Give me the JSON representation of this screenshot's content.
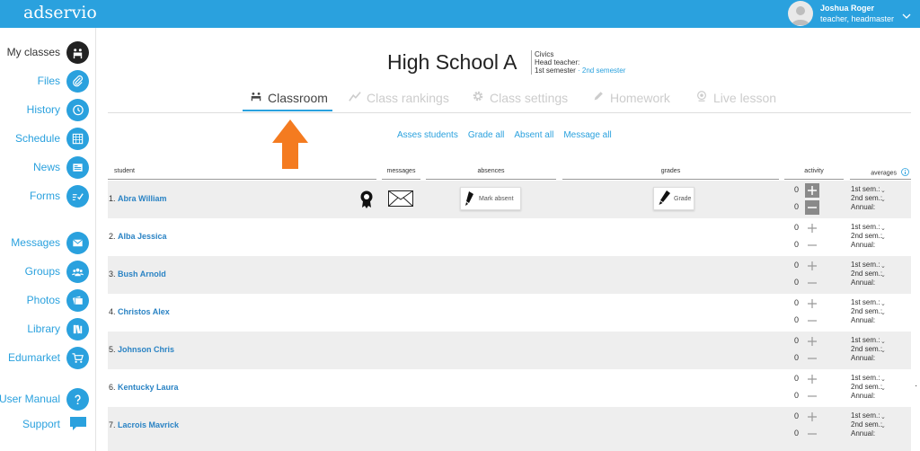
{
  "app": {
    "logo": "adservio"
  },
  "user": {
    "name": "Joshua Roger",
    "role": "teacher, headmaster"
  },
  "sidebar": {
    "items": [
      {
        "label": "My classes",
        "icon": "classroom-icon",
        "active": true
      },
      {
        "label": "Files",
        "icon": "paperclip-icon"
      },
      {
        "label": "History",
        "icon": "history-icon"
      },
      {
        "label": "Schedule",
        "icon": "calendar-icon"
      },
      {
        "label": "News",
        "icon": "newspaper-icon"
      },
      {
        "label": "Forms",
        "icon": "form-check-icon"
      },
      {
        "label": "Messages",
        "icon": "envelope-icon"
      },
      {
        "label": "Groups",
        "icon": "group-icon"
      },
      {
        "label": "Photos",
        "icon": "photos-icon"
      },
      {
        "label": "Library",
        "icon": "library-icon"
      },
      {
        "label": "Edumarket",
        "icon": "cart-icon"
      },
      {
        "label": "User Manual",
        "icon": "question-icon"
      },
      {
        "label": "Support",
        "icon": "chat-icon"
      }
    ]
  },
  "header": {
    "school": "High School A",
    "subject": "Civics",
    "head_teacher": "Head teacher:",
    "semester_active": "1st semester",
    "semester_sep": " · ",
    "semester_other": "2nd semester"
  },
  "tabs": [
    {
      "label": "Classroom",
      "icon": "classroom-icon",
      "active": true
    },
    {
      "label": "Class rankings",
      "icon": "chart-line-icon"
    },
    {
      "label": "Class settings",
      "icon": "gear-icon"
    },
    {
      "label": "Homework",
      "icon": "pencil-icon"
    },
    {
      "label": "Live lesson",
      "icon": "webcam-icon"
    }
  ],
  "actions": [
    "Asses students",
    "Grade all",
    "Absent all",
    "Message all"
  ],
  "columns": {
    "student": "student",
    "messages": "messages",
    "absences": "absences",
    "grades": "grades",
    "activity": "activity",
    "averages": "averages"
  },
  "buttons": {
    "mark_absent": "Mark absent",
    "grade": "Grade"
  },
  "averages_labels": {
    "sem1": "1st sem.:",
    "sem2": "2nd sem.:",
    "annual": "Annual:"
  },
  "students": [
    {
      "num": "1.",
      "name": "Abra William",
      "activity_plus": "0",
      "activity_minus": "0"
    },
    {
      "num": "2.",
      "name": "Alba Jessica",
      "activity_plus": "0",
      "activity_minus": "0"
    },
    {
      "num": "3.",
      "name": "Bush Arnold",
      "activity_plus": "0",
      "activity_minus": "0"
    },
    {
      "num": "4.",
      "name": "Christos Alex",
      "activity_plus": "0",
      "activity_minus": "0"
    },
    {
      "num": "5.",
      "name": "Johnson Chris",
      "activity_plus": "0",
      "activity_minus": "0"
    },
    {
      "num": "6.",
      "name": "Kentucky Laura",
      "activity_plus": "0",
      "activity_minus": "0"
    },
    {
      "num": "7.",
      "name": "Lacrois Mavrick",
      "activity_plus": "0",
      "activity_minus": "0"
    }
  ],
  "colors": {
    "brand": "#2aa1de",
    "annotation_arrow": "#f47b20",
    "row_alt": "#eeeeee"
  }
}
